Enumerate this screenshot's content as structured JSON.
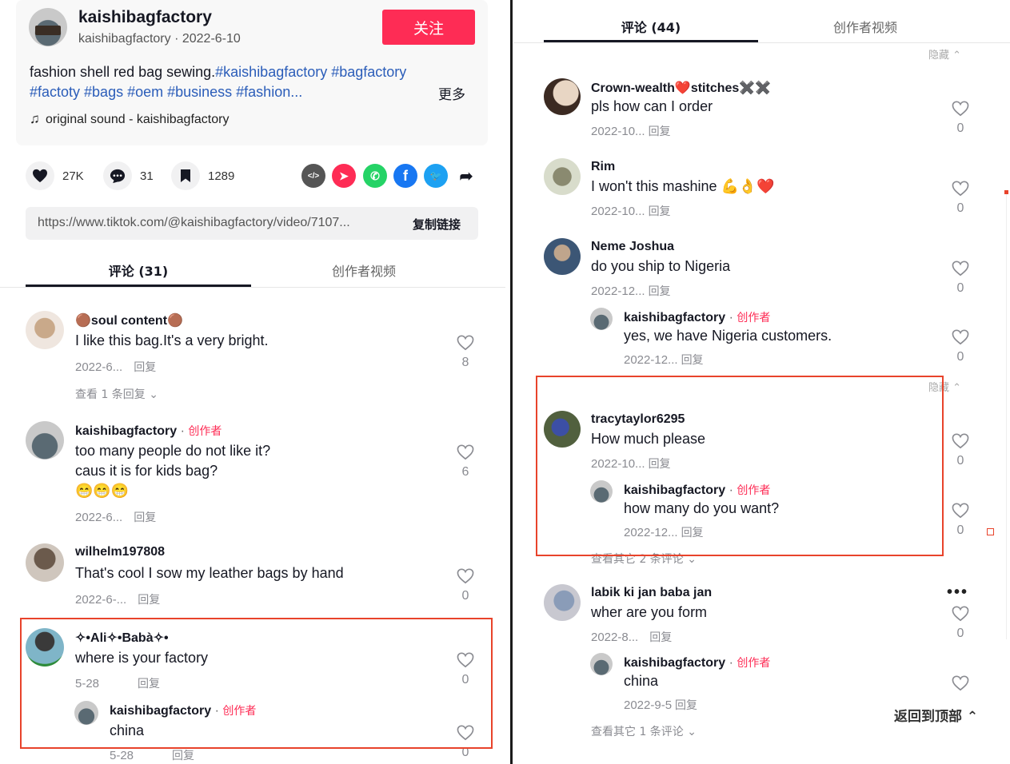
{
  "left": {
    "author": {
      "name": "kaishibagfactory",
      "handle": "kaishibagfactory",
      "date": "2022-6-10"
    },
    "follow_label": "关注",
    "description": {
      "text": "fashion shell red bag sewing.",
      "tags_line1": "#kaishibagfactory #bagfactory",
      "tags_line2": "#factoty #bags #oem #business #fashion...",
      "more_label": "更多"
    },
    "sound": "original sound - kaishibagfactory",
    "actions": {
      "likes": "27K",
      "comments": "31",
      "saves": "1289"
    },
    "share_icons": [
      {
        "name": "embed-icon",
        "color": "#555555",
        "glyph": "</>"
      },
      {
        "name": "send-icon",
        "color": "#fe2c55",
        "glyph": "➤"
      },
      {
        "name": "whatsapp-icon",
        "color": "#25d366",
        "glyph": "✆"
      },
      {
        "name": "facebook-icon",
        "color": "#1877f2",
        "glyph": "f"
      },
      {
        "name": "twitter-icon",
        "color": "#1da1f2",
        "glyph": "🐦"
      }
    ],
    "link": {
      "url": "https://www.tiktok.com/@kaishibagfactory/video/7107...",
      "copy_label": "复制链接"
    },
    "tabs": {
      "comments": "评论 (31)",
      "creator_videos": "创作者视频"
    },
    "comments": [
      {
        "user": "🟤soul content🟤",
        "text": "I like this bag.It's a very bright.",
        "date": "2022-6...",
        "reply_label": "回复",
        "likes": "8",
        "view_replies": "查看 1 条回复"
      },
      {
        "user": "kaishibagfactory",
        "badge": "创作者",
        "text": "too many people do not like it?",
        "text2": "caus it is for kids bag?",
        "text3": "😁😁😁",
        "date": "2022-6...",
        "reply_label": "回复",
        "likes": "6"
      },
      {
        "user": "wilhelm197808",
        "text": "That's cool I sow my leather bags by hand",
        "date": "2022-6-...",
        "reply_label": "回复",
        "likes": "0"
      },
      {
        "user": "✧•Ali✧•Babà✧•",
        "text": "where is your factory",
        "date": "5-28",
        "reply_label": "回复",
        "likes": "0"
      },
      {
        "user": "kaishibagfactory",
        "badge": "创作者",
        "text": "china",
        "date": "5-28",
        "reply_label": "回复",
        "likes": "0"
      }
    ]
  },
  "right": {
    "tabs": {
      "comments": "评论 (44)",
      "creator_videos": "创作者视频"
    },
    "hide_label": "隐藏",
    "back_to_top": "返回到顶部",
    "more_dots": "•••",
    "comments": [
      {
        "user": "Crown-wealth❤️stitches✖️✖️",
        "text": "pls how can I order",
        "date": "2022-10...",
        "reply_label": "回复",
        "likes": "0"
      },
      {
        "user": "Rim",
        "text": "I won't this mashine 💪👌❤️",
        "date": "2022-10...",
        "reply_label": "回复",
        "likes": "0"
      },
      {
        "user": "Neme Joshua",
        "text": "do you ship to Nigeria",
        "date": "2022-12...",
        "reply_label": "回复",
        "likes": "0"
      },
      {
        "user": "kaishibagfactory",
        "badge": "创作者",
        "text": "yes, we have Nigeria customers.",
        "date": "2022-12...",
        "reply_label": "回复",
        "likes": "0"
      },
      {
        "user": "tracytaylor6295",
        "text": "How much please",
        "date": "2022-10...",
        "reply_label": "回复",
        "likes": "0"
      },
      {
        "user": "kaishibagfactory",
        "badge": "创作者",
        "text": "how many do you want?",
        "date": "2022-12...",
        "reply_label": "回复",
        "likes": "0"
      },
      {
        "user": "labik ki jan baba jan",
        "text": "wher are you form",
        "date": "2022-8...",
        "reply_label": "回复",
        "likes": "0"
      },
      {
        "user": "kaishibagfactory",
        "badge": "创作者",
        "text": "china",
        "date": "2022-9-5",
        "reply_label": "回复"
      }
    ],
    "view_more_1": "查看其它 2 条评论",
    "view_more_2": "查看其它 1 条评论"
  }
}
